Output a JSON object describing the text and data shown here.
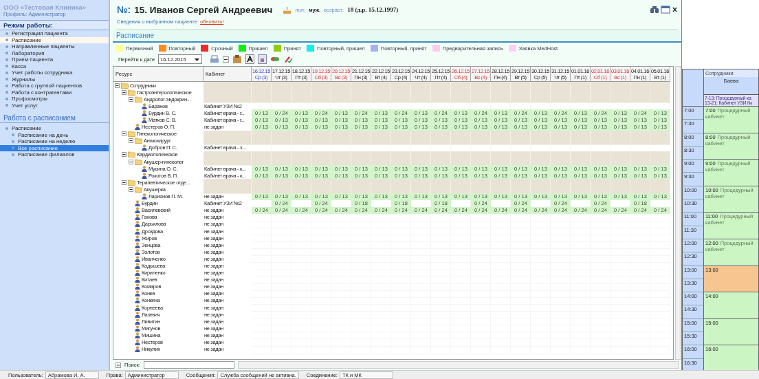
{
  "sidebar": {
    "org": "ООО «Тестовая Клиника»",
    "profile": "Профиль: Администратор",
    "mode_title": "Режим работы:",
    "mode_items": [
      {
        "label": "Регистрация пациента",
        "selected": false
      },
      {
        "label": "Расписание",
        "selected": true
      },
      {
        "label": "Направленные пациенты",
        "selected": false
      },
      {
        "label": "Лаборатория",
        "selected": false
      },
      {
        "label": "Прием пациента",
        "selected": false
      },
      {
        "label": "Касса",
        "selected": false
      },
      {
        "label": "Учет работы сотрудника",
        "selected": false
      },
      {
        "label": "Журналы",
        "selected": false
      },
      {
        "label": "Работа с группой пациентов",
        "selected": false
      },
      {
        "label": "Работа с контрагентами",
        "selected": false
      },
      {
        "label": "Профосмотры",
        "selected": false
      },
      {
        "label": "Учет услуг",
        "selected": false
      }
    ],
    "schedule_title": "Работа с расписанием",
    "schedule_tree": [
      {
        "label": "Расписание",
        "selected": false,
        "children": [
          {
            "label": "Расписание на день",
            "selected": false
          },
          {
            "label": "Расписание на неделю",
            "selected": false
          },
          {
            "label": "Все расписание",
            "selected": true
          },
          {
            "label": "Расписание филиалов",
            "selected": false
          }
        ]
      }
    ]
  },
  "patient": {
    "number_label": "№:",
    "name": "15. Иванов Сергей Андреевич",
    "sex_label": "пол:",
    "sex": "муж.",
    "age_label": "возраст:",
    "age": "18 (д.р. 15.12.1997)",
    "info": "Сведения о выбранном пациенте",
    "refresh": "обновить!"
  },
  "section_title": "Расписание",
  "legend": [
    {
      "label": "Первичный",
      "color": "#ffff99"
    },
    {
      "label": "Повторный",
      "color": "#ff8c1a"
    },
    {
      "label": "Срочный",
      "color": "#ee2b2b"
    },
    {
      "label": "Пришел",
      "color": "#11ee11"
    },
    {
      "label": "Принят",
      "color": "#8fcc11"
    },
    {
      "label": "Повторный, пришел",
      "color": "#11eeee"
    },
    {
      "label": "Повторный, принят",
      "color": "#a8b2ee"
    },
    {
      "label": "Предварительная запись",
      "color": "#ffccee"
    },
    {
      "label": "Заявка MedHost",
      "color": "#ffcff2"
    }
  ],
  "toolbar": {
    "goto_label": "Перейти к дате",
    "date": "16.12.2015"
  },
  "table": {
    "columns": [
      "Ресурс",
      "Кабинет"
    ],
    "dates": [
      {
        "date": "16.12.15",
        "day": "Ср (3)",
        "kind": "today"
      },
      {
        "date": "17.12.15",
        "day": "Чт (3)",
        "kind": "weekday"
      },
      {
        "date": "18.12.15",
        "day": "Пт (3)",
        "kind": "weekday"
      },
      {
        "date": "19.12.15",
        "day": "Сб (3)",
        "kind": "weekend"
      },
      {
        "date": "20.12.15",
        "day": "Вс (3)",
        "kind": "weekend"
      },
      {
        "date": "21.12.15",
        "day": "Пн (3)",
        "kind": "weekday"
      },
      {
        "date": "22.12.15",
        "day": "Вт (4)",
        "kind": "weekday"
      },
      {
        "date": "23.12.15",
        "day": "Ср (4)",
        "kind": "weekday"
      },
      {
        "date": "24.12.15",
        "day": "Чт (4)",
        "kind": "weekday"
      },
      {
        "date": "25.12.15",
        "day": "Пт (4)",
        "kind": "weekday"
      },
      {
        "date": "26.12.15",
        "day": "Сб (4)",
        "kind": "weekend"
      },
      {
        "date": "27.12.15",
        "day": "Вс (4)",
        "kind": "weekend"
      },
      {
        "date": "28.12.15",
        "day": "Пн (4)",
        "kind": "weekday"
      },
      {
        "date": "29.12.15",
        "day": "Вт (5)",
        "kind": "weekday"
      },
      {
        "date": "30.12.15",
        "day": "Ср (5)",
        "kind": "weekday"
      },
      {
        "date": "31.12.15",
        "day": "Чт (5)",
        "kind": "weekday"
      },
      {
        "date": "01.01.16",
        "day": "Пт (1)",
        "kind": "weekday"
      },
      {
        "date": "02.01.16",
        "day": "Сб (1)",
        "kind": "weekend"
      },
      {
        "date": "03.01.16",
        "day": "Вс (1)",
        "kind": "weekend"
      },
      {
        "date": "04.01.16",
        "day": "Пн (1)",
        "kind": "weekday"
      },
      {
        "date": "05.01.16",
        "day": "Вт (1)",
        "kind": "weekday"
      }
    ],
    "rows": [
      {
        "kind": "folder",
        "name": "Сотрудники",
        "expanded": true,
        "children": [
          {
            "kind": "folder",
            "name": "Гастроэнтерологическое",
            "expanded": true,
            "children": [
              {
                "kind": "folder",
                "name": "Андролог-эндокрин...",
                "expanded": true,
                "children": [
                  {
                    "kind": "person",
                    "name": "Баранов",
                    "cabinet": "Кабинет УЗИ №2"
                  },
                  {
                    "kind": "person",
                    "name": "Бурдин В. С.",
                    "cabinet": "Кабинет врача - г...",
                    "cells": [
                      "0 / 13",
                      "0 / 24",
                      "0 / 13",
                      "0 / 24",
                      "0 / 13",
                      "0 / 24",
                      "0 / 13",
                      "0 / 24",
                      "0 / 13",
                      "0 / 24",
                      "0 / 13",
                      "0 / 24",
                      "0 / 13",
                      "0 / 24",
                      "0 / 13",
                      "0 / 24",
                      "0 / 13",
                      "0 / 24",
                      "0 / 13",
                      "0 / 24",
                      "0 / 13"
                    ]
                  },
                  {
                    "kind": "person",
                    "name": "Матков С. В.",
                    "cabinet": "Кабинет врача - г...",
                    "cells": [
                      "0 / 13",
                      "0 / 13",
                      "0 / 13",
                      "0 / 13",
                      "0 / 13",
                      "0 / 13",
                      "0 / 13",
                      "0 / 13",
                      "0 / 13",
                      "0 / 13",
                      "0 / 13",
                      "0 / 13",
                      "0 / 13",
                      "0 / 13",
                      "0 / 13",
                      "0 / 13",
                      "0 / 13",
                      "0 / 13",
                      "0 / 13",
                      "0 / 13",
                      "0 / 13"
                    ]
                  }
                ]
              },
              {
                "kind": "person",
                "name": "Нестеров О. П.",
                "cabinet": "не задан",
                "cells": [
                  "0 / 13",
                  "0 / 13",
                  "0 / 13",
                  "0 / 13",
                  "0 / 13",
                  "0 / 13",
                  "0 / 13",
                  "0 / 13",
                  "0 / 13",
                  "0 / 13",
                  "0 / 13",
                  "0 / 13",
                  "0 / 13",
                  "0 / 13",
                  "0 / 13",
                  "0 / 13",
                  "0 / 13",
                  "0 / 13",
                  "0 / 13",
                  "0 / 13",
                  "0 / 13"
                ]
              }
            ]
          },
          {
            "kind": "folder",
            "name": "Гинекологическое",
            "expanded": true,
            "children": [
              {
                "kind": "folder",
                "name": "Ангиохирург",
                "expanded": true,
                "children": [
                  {
                    "kind": "person",
                    "name": "Добров П. С.",
                    "cabinet": "Кабинет врача - х..."
                  }
                ]
              }
            ]
          },
          {
            "kind": "folder",
            "name": "Кардиологическое",
            "expanded": true,
            "children": [
              {
                "kind": "folder",
                "name": "Акушер-гинеколог",
                "expanded": true,
                "children": [
                  {
                    "kind": "person",
                    "name": "Мусина О. С.",
                    "cabinet": "Кабинет врача - к...",
                    "cells": [
                      "0 / 13",
                      "0 / 13",
                      "0 / 13",
                      "0 / 13",
                      "0 / 13",
                      "0 / 13",
                      "0 / 13",
                      "0 / 13",
                      "0 / 13",
                      "0 / 13",
                      "0 / 13",
                      "0 / 13",
                      "0 / 13",
                      "0 / 13",
                      "0 / 13",
                      "0 / 13",
                      "0 / 13",
                      "0 / 13",
                      "0 / 13",
                      "0 / 13",
                      "0 / 13"
                    ]
                  },
                  {
                    "kind": "person",
                    "name": "Рокотов В. П.",
                    "cabinet": "Кабинет врача - к...",
                    "cells": [
                      "0 / 13",
                      "0 / 13",
                      "0 / 13",
                      "0 / 13",
                      "0 / 13",
                      "0 / 13",
                      "0 / 13",
                      "0 / 13",
                      "0 / 13",
                      "0 / 13",
                      "0 / 13",
                      "0 / 13",
                      "0 / 13",
                      "0 / 13",
                      "0 / 13",
                      "0 / 13",
                      "0 / 13",
                      "0 / 13",
                      "0 / 13",
                      "0 / 13",
                      "0 / 13"
                    ]
                  }
                ]
              }
            ]
          },
          {
            "kind": "folder",
            "name": "Терапевтическое отде...",
            "expanded": true,
            "children": [
              {
                "kind": "folder",
                "name": "Акушерка",
                "expanded": true,
                "children": [
                  {
                    "kind": "person",
                    "name": "Ларионов П. М.",
                    "cabinet": "не задан",
                    "cells": [
                      "0 / 13",
                      "0 / 13",
                      "0 / 13",
                      "0 / 13",
                      "0 / 13",
                      "0 / 13",
                      "0 / 13",
                      "0 / 13",
                      "0 / 13",
                      "0 / 13",
                      "0 / 13",
                      "0 / 13",
                      "0 / 13",
                      "0 / 13",
                      "0 / 13",
                      "0 / 13",
                      "0 / 13",
                      "0 / 13",
                      "0 / 13",
                      "0 / 13",
                      "0 / 13"
                    ]
                  }
                ]
              },
              {
                "kind": "person",
                "name": "Бурдин",
                "cabinet": "Кабинет УЗИ №2",
                "cells": [
                  null,
                  "0 / 24",
                  null,
                  "0 / 24",
                  null,
                  "0 / 18",
                  null,
                  "0 / 18",
                  null,
                  "0 / 18",
                  null,
                  "0 / 24",
                  null,
                  "0 / 24",
                  null,
                  "0 / 24",
                  null,
                  "0 / 24",
                  null,
                  "0 / 18",
                  null
                ]
              },
              {
                "kind": "person",
                "name": "Василевский",
                "cabinet": "не задан",
                "cells": [
                  "0 / 24",
                  "0 / 24",
                  "0 / 24",
                  "0 / 24",
                  "0 / 24",
                  "0 / 24",
                  "0 / 24",
                  "0 / 24",
                  "0 / 24",
                  "0 / 24",
                  "0 / 24",
                  "0 / 24",
                  "0 / 24",
                  "0 / 24",
                  "0 / 24",
                  "0 / 24",
                  "0 / 24",
                  "0 / 24",
                  "0 / 24",
                  "0 / 24",
                  "0 / 24"
                ]
              },
              {
                "kind": "person",
                "name": "Ганова",
                "cabinet": "не задан"
              },
              {
                "kind": "person",
                "name": "Дарьялова",
                "cabinet": "не задан"
              },
              {
                "kind": "person",
                "name": "Дроздова",
                "cabinet": "не задан"
              },
              {
                "kind": "person",
                "name": "Жиров",
                "cabinet": "не задан"
              },
              {
                "kind": "person",
                "name": "Зенцова",
                "cabinet": "не задан"
              },
              {
                "kind": "person",
                "name": "Золотов",
                "cabinet": "не задан"
              },
              {
                "kind": "person",
                "name": "Иванченко",
                "cabinet": "не задан"
              },
              {
                "kind": "person",
                "name": "Кадышева",
                "cabinet": "не задан"
              },
              {
                "kind": "person",
                "name": "Кириленко",
                "cabinet": "не задан"
              },
              {
                "kind": "person",
                "name": "Китаев",
                "cabinet": "не задан"
              },
              {
                "kind": "person",
                "name": "Комаров",
                "cabinet": "не задан"
              },
              {
                "kind": "person",
                "name": "Конев",
                "cabinet": "не задан"
              },
              {
                "kind": "person",
                "name": "Конкина",
                "cabinet": "не задан"
              },
              {
                "kind": "person",
                "name": "Корнеева",
                "cabinet": "не задан"
              },
              {
                "kind": "person",
                "name": "Лазевич",
                "cabinet": "не задан"
              },
              {
                "kind": "person",
                "name": "Ливитин",
                "cabinet": "не задан"
              },
              {
                "kind": "person",
                "name": "Мигунов",
                "cabinet": "не задан"
              },
              {
                "kind": "person",
                "name": "Мишина",
                "cabinet": "не задан"
              },
              {
                "kind": "person",
                "name": "Нестеров",
                "cabinet": "не задан"
              },
              {
                "kind": "person",
                "name": "Никулин",
                "cabinet": "не задан"
              }
            ]
          }
        ]
      }
    ]
  },
  "search": {
    "label": "Поиск:"
  },
  "right_panel": {
    "header": "Сотрудники",
    "employee": "Баева",
    "shifts": [
      "7-13: Процедурный ка",
      "13-21: Кабинет УЗИ №"
    ],
    "times": [
      "7:00",
      "7:30",
      "8:00",
      "8:30",
      "9:00",
      "9:30",
      "10:00",
      "10:30",
      "11:00",
      "11:30",
      "12:00",
      "12:30",
      "13:00",
      "13:30",
      "14:00",
      "14:30",
      "15:00",
      "15:30",
      "16:00",
      "16:30"
    ],
    "slots": [
      {
        "time": "7:00",
        "label": "Процедурный кабинет",
        "color": "#ccf5c4"
      },
      {
        "time": "8:00",
        "label": "Процедурный кабинет",
        "color": "#ccf5c4"
      },
      {
        "time": "9:00",
        "label": "Процедурный кабинет",
        "color": "#ccf5c4"
      },
      {
        "time": "10:00",
        "label": "Процедурный кабинет",
        "color": "#ccf5c4"
      },
      {
        "time": "11:00",
        "label": "Процедурный кабинет",
        "color": "#ccf5c4"
      },
      {
        "time": "12:00",
        "label": "Процедурный кабинет",
        "color": "#ccf5c4"
      },
      {
        "time": "13:00",
        "color": "#f7c590"
      },
      {
        "time": "14:00",
        "color": "#ccf5c4"
      },
      {
        "time": "15:00",
        "color": "#ccf5c4"
      },
      {
        "time": "16:00",
        "color": "#ccf5c4"
      }
    ]
  },
  "status_bar": [
    {
      "label": "Пользователь:",
      "value": "Абрамова И. А."
    },
    {
      "label": "Права:",
      "value": "Администратор"
    },
    {
      "label": "Сообщения:",
      "value": "Служба сообщений не активна."
    },
    {
      "label": "Соединение:",
      "value": "ТК и МК"
    }
  ]
}
